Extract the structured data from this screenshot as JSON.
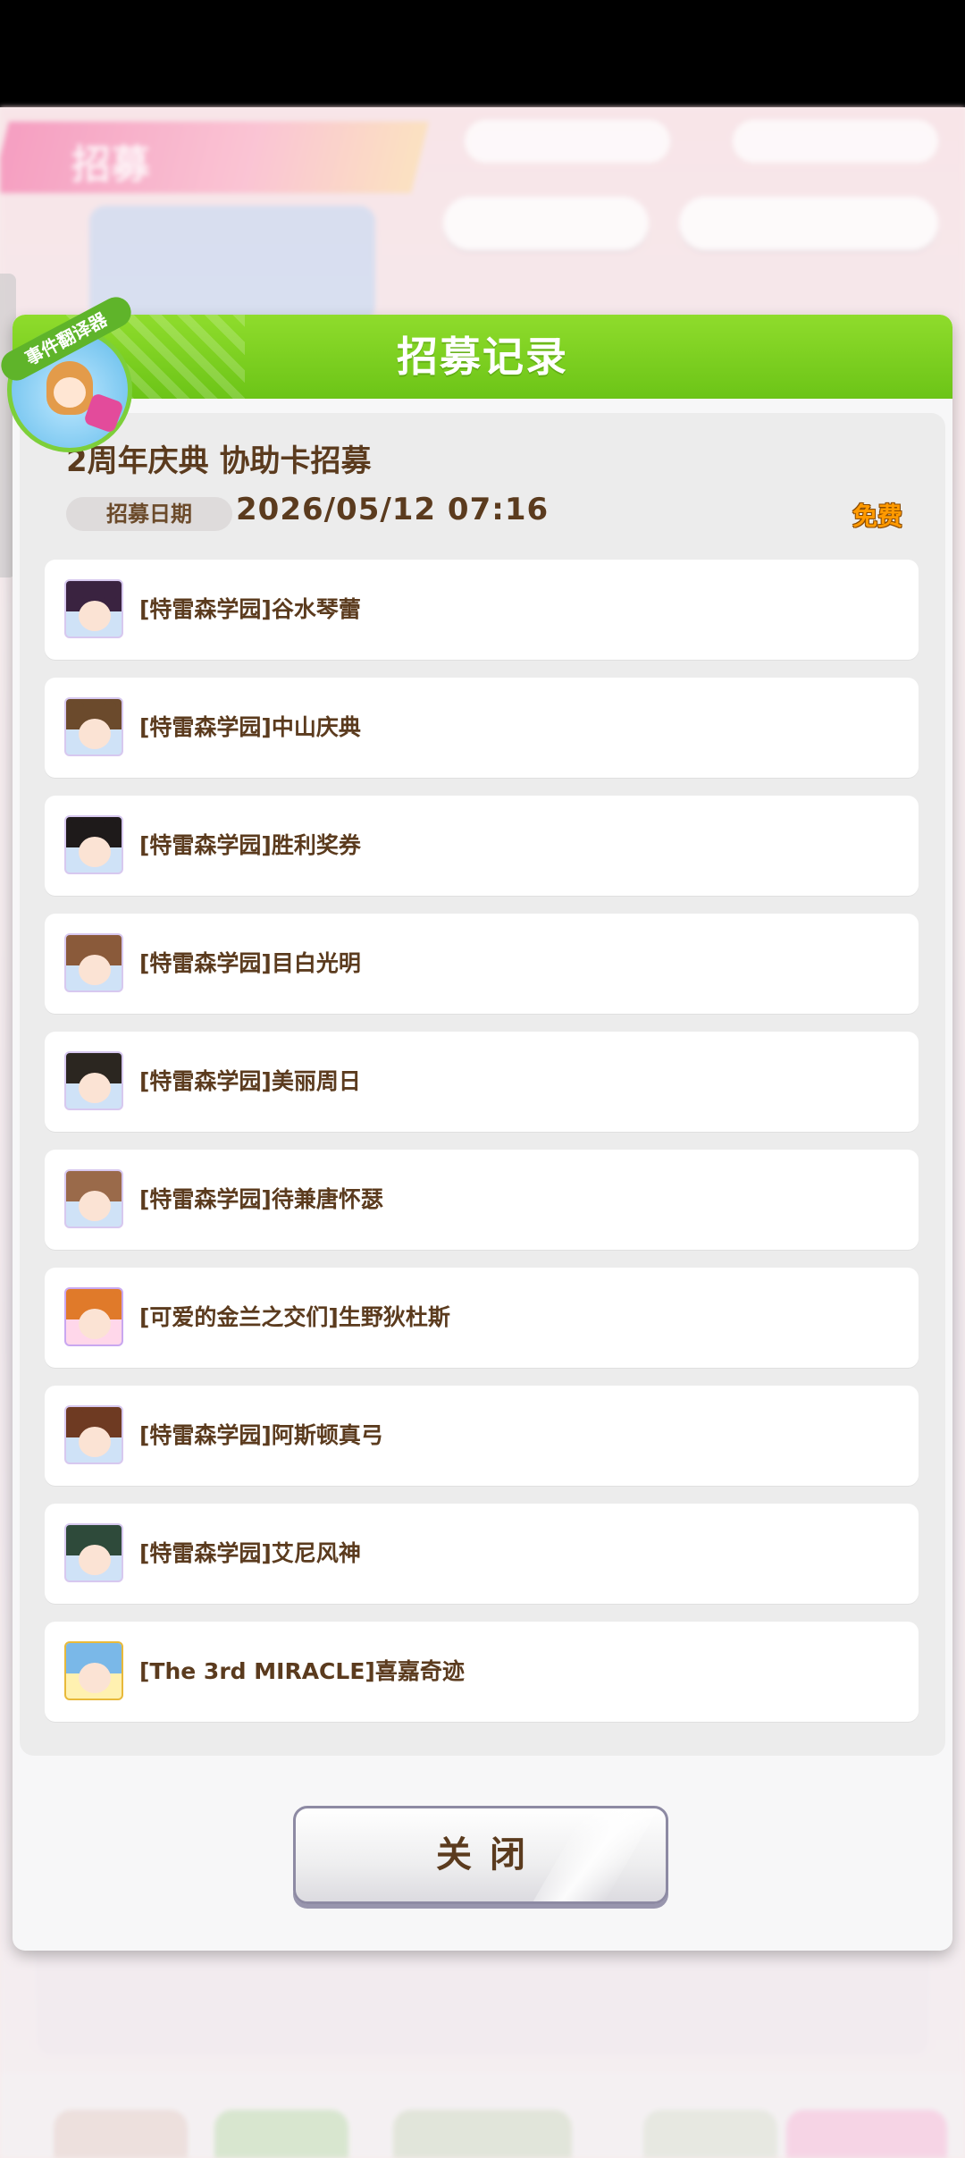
{
  "modal": {
    "title": "招募记录",
    "gacha_name": "2周年庆典  协助卡招募",
    "date_label": "招募日期",
    "date_value": "2026/05/12  07:16",
    "badge": "免费",
    "close_label": "关闭"
  },
  "results": [
    {
      "label": "[特雷森学园]谷水琴蕾",
      "hair": "#3a2340",
      "ear": "#3a2340"
    },
    {
      "label": "[特雷森学园]中山庆典",
      "hair": "#6b4a2c",
      "ear": "#6b4a2c"
    },
    {
      "label": "[特雷森学园]胜利奖券",
      "hair": "#1e1a1a",
      "ear": "#1e1a1a"
    },
    {
      "label": "[特雷森学园]目白光明",
      "hair": "#8a5a3a",
      "ear": "#8a5a3a"
    },
    {
      "label": "[特雷森学园]美丽周日",
      "hair": "#2b2620",
      "ear": "#2b2620"
    },
    {
      "label": "[特雷森学园]待兼唐怀瑟",
      "hair": "#9a6a4a",
      "ear": "#9a6a4a"
    },
    {
      "label": "[可爱的金兰之交们]生野狄杜斯",
      "hair": "#e07a2a",
      "ear": "#e07a2a"
    },
    {
      "label": "[特雷森学园]阿斯顿真弓",
      "hair": "#6e3a22",
      "ear": "#6e3a22"
    },
    {
      "label": "[特雷森学园]艾尼风神",
      "hair": "#2e4a3a",
      "ear": "#2e4a3a"
    },
    {
      "label": "[The  3rd  MIRACLE]喜嘉奇迹",
      "hair": "#7ab8e8",
      "ear": "#7ab8e8"
    }
  ],
  "translator": {
    "ribbon_text": "事件翻译器"
  },
  "background": {
    "banner_text": "招募"
  }
}
